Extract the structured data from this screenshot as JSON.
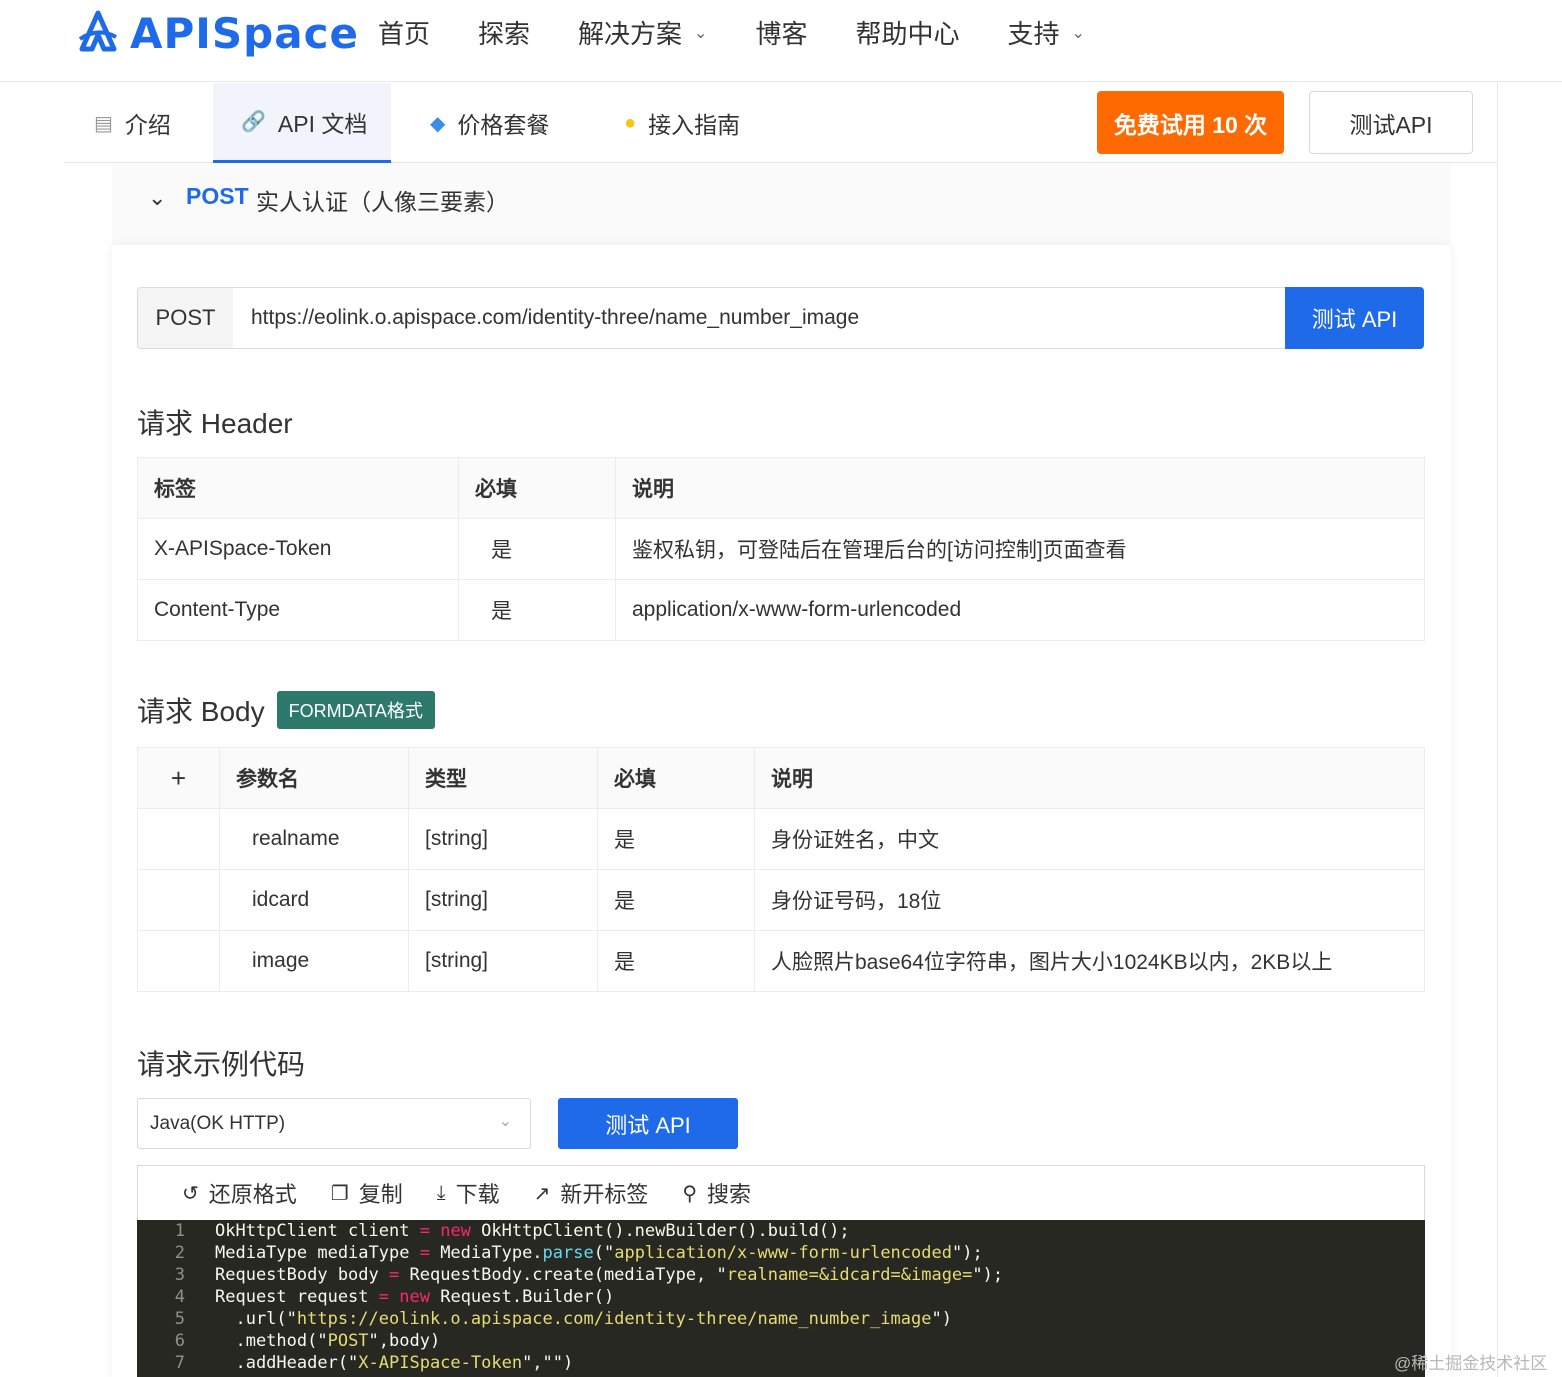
{
  "brand": {
    "name": "APISpace"
  },
  "nav": {
    "items": [
      {
        "label": "首页",
        "dropdown": false
      },
      {
        "label": "探索",
        "dropdown": false
      },
      {
        "label": "解决方案",
        "dropdown": true
      },
      {
        "label": "博客",
        "dropdown": false
      },
      {
        "label": "帮助中心",
        "dropdown": false
      },
      {
        "label": "支持",
        "dropdown": true
      }
    ]
  },
  "tabs": [
    {
      "label": "介绍",
      "icon": "document-icon"
    },
    {
      "label": "API 文档",
      "icon": "link-icon",
      "active": true
    },
    {
      "label": "价格套餐",
      "icon": "diamond-icon"
    },
    {
      "label": "接入指南",
      "icon": "lightbulb-icon"
    }
  ],
  "actions": {
    "trial_label": "免费试用 10 次",
    "test_label": "测试API"
  },
  "endpoint": {
    "method": "POST",
    "title": "实人认证（人像三要素）",
    "url": "https://eolink.o.apispace.com/identity-three/name_number_image",
    "test_button": "测试 API"
  },
  "request_header": {
    "title": "请求 Header",
    "columns": [
      "标签",
      "必填",
      "说明"
    ],
    "rows": [
      [
        "X-APISpace-Token",
        "是",
        "鉴权私钥，可登陆后在管理后台的[访问控制]页面查看"
      ],
      [
        "Content-Type",
        "是",
        "application/x-www-form-urlencoded"
      ]
    ]
  },
  "request_body": {
    "title": "请求 Body",
    "badge": "FORMDATA格式",
    "plus": "+",
    "columns": [
      "参数名",
      "类型",
      "必填",
      "说明"
    ],
    "rows": [
      [
        "realname",
        "[string]",
        "是",
        "身份证姓名，中文"
      ],
      [
        "idcard",
        "[string]",
        "是",
        "身份证号码，18位"
      ],
      [
        "image",
        "[string]",
        "是",
        "人脸照片base64位字符串，图片大小1024KB以内，2KB以上"
      ]
    ]
  },
  "code_sample": {
    "title": "请求示例代码",
    "language": "Java(OK HTTP)",
    "test_button": "测试 API",
    "toolbar": [
      {
        "label": "还原格式",
        "icon": "undo-icon"
      },
      {
        "label": "复制",
        "icon": "copy-icon"
      },
      {
        "label": "下载",
        "icon": "download-icon"
      },
      {
        "label": "新开标签",
        "icon": "external-link-icon"
      },
      {
        "label": "搜索",
        "icon": "search-icon"
      }
    ],
    "lines": [
      "OkHttpClient client = new OkHttpClient().newBuilder().build();",
      "MediaType mediaType = MediaType.parse(\"application/x-www-form-urlencoded\");",
      "RequestBody body = RequestBody.create(mediaType, \"realname=&idcard=&image=\");",
      "Request request = new Request.Builder()",
      "  .url(\"https://eolink.o.apispace.com/identity-three/name_number_image\")",
      "  .method(\"POST\",body)",
      "  .addHeader(\"X-APISpace-Token\",\"\")"
    ]
  },
  "watermark": "@稀土掘金技术社区",
  "colors": {
    "primary": "#1f6ae8",
    "trial": "#ff6a00",
    "badge": "#2d7a6c",
    "code_bg": "#272822"
  }
}
